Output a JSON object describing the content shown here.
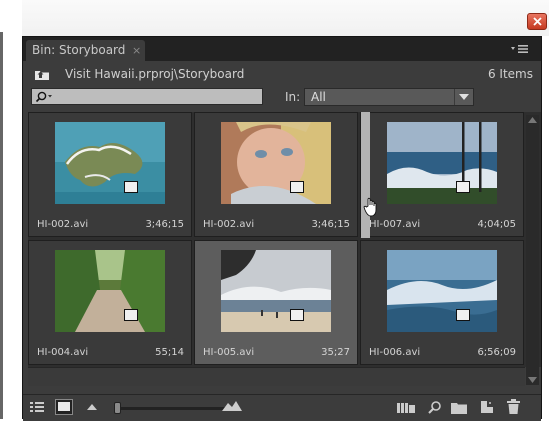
{
  "window": {
    "close_icon": "close-icon",
    "close_color": "#d9534f"
  },
  "panel": {
    "tab_label": "Bin: Storyboard",
    "tab_close": "×",
    "path": "Visit Hawaii.prproj\\Storyboard",
    "item_count": "6 Items",
    "search_value": "",
    "in_label": "In:",
    "in_value": "All"
  },
  "clips": [
    {
      "name": "HI-002.avi",
      "duration": "3;46;15",
      "thumb": "aerial-island"
    },
    {
      "name": "HI-002.avi",
      "duration": "3;46;15",
      "thumb": "child-face"
    },
    {
      "name": "HI-007.avi",
      "duration": "4;04;05",
      "thumb": "ocean-poles"
    },
    {
      "name": "HI-004.avi",
      "duration": "55;14",
      "thumb": "forest-path"
    },
    {
      "name": "HI-005.avi",
      "duration": "35;27",
      "thumb": "beach-waves"
    },
    {
      "name": "HI-006.avi",
      "duration": "6;56;09",
      "thumb": "surf-wave"
    }
  ],
  "bottom": {
    "zoom_level": 0.02,
    "icons": [
      "list-view-icon",
      "icon-view-icon",
      "zoom-out-icon",
      "zoom-in-icon",
      "automate-to-sequence-icon",
      "find-icon",
      "new-bin-icon",
      "new-item-icon",
      "delete-icon"
    ]
  }
}
